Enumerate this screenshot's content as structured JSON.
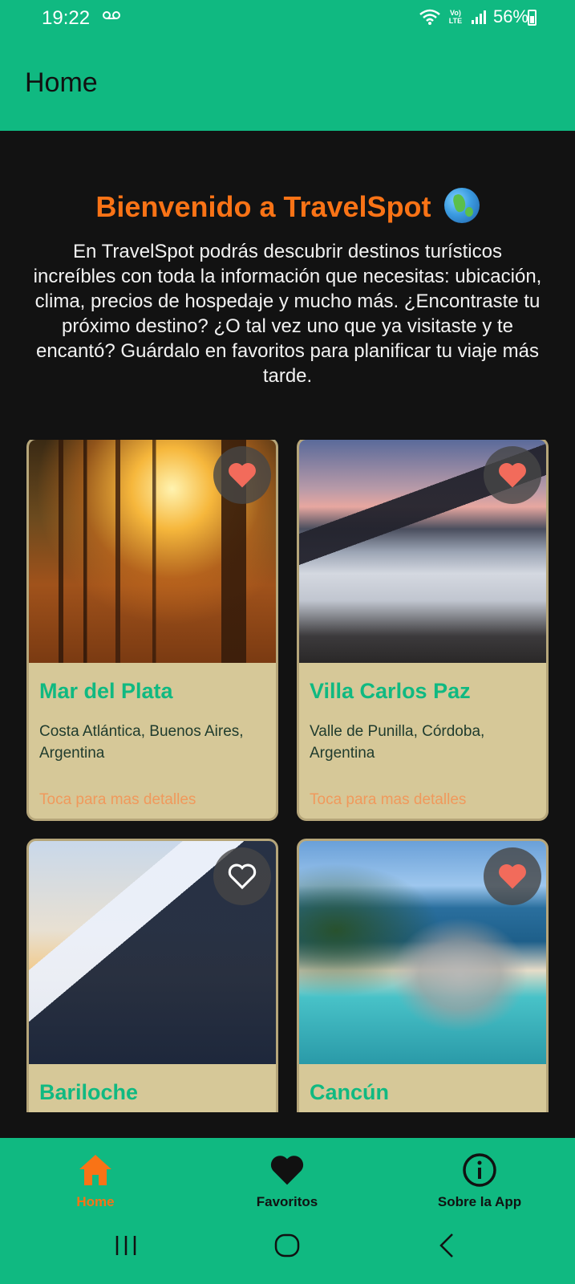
{
  "status_bar": {
    "time": "19:22",
    "network": "Vo) LTE",
    "battery": "56%"
  },
  "app_bar": {
    "title": "Home"
  },
  "welcome": {
    "title": "Bienvenido a TravelSpot",
    "text": "En TravelSpot podrás descubrir destinos turísticos increíbles con toda la información que necesitas: ubicación, clima, precios de hospedaje y mucho más. ¿Encontraste tu próximo destino? ¿O tal vez uno que ya visitaste y te encantó? Guárdalo en favoritos para planificar tu viaje más tarde."
  },
  "destinations": [
    {
      "name": "Mar del Plata",
      "location": "Costa Atlántica, Buenos Aires, Argentina",
      "hint": "Toca para mas detalles",
      "favorite": true,
      "image": "autumn-forest"
    },
    {
      "name": "Villa Carlos Paz",
      "location": "Valle de Punilla, Córdoba, Argentina",
      "hint": "Toca para mas detalles",
      "favorite": true,
      "image": "mountains-above-clouds"
    },
    {
      "name": "Bariloche",
      "location": "",
      "hint": "",
      "favorite": false,
      "image": "snowy-peak"
    },
    {
      "name": "Cancún",
      "location": "",
      "hint": "",
      "favorite": true,
      "image": "tropical-beach"
    }
  ],
  "bottom_nav": [
    {
      "label": "Home",
      "icon": "home-icon",
      "active": true
    },
    {
      "label": "Favoritos",
      "icon": "heart-icon",
      "active": false
    },
    {
      "label": "Sobre la App",
      "icon": "info-icon",
      "active": false
    }
  ],
  "colors": {
    "primary": "#10b981",
    "accent": "#f97316",
    "card": "#d6c898",
    "background": "#121212",
    "heart": "#f26b5b"
  }
}
